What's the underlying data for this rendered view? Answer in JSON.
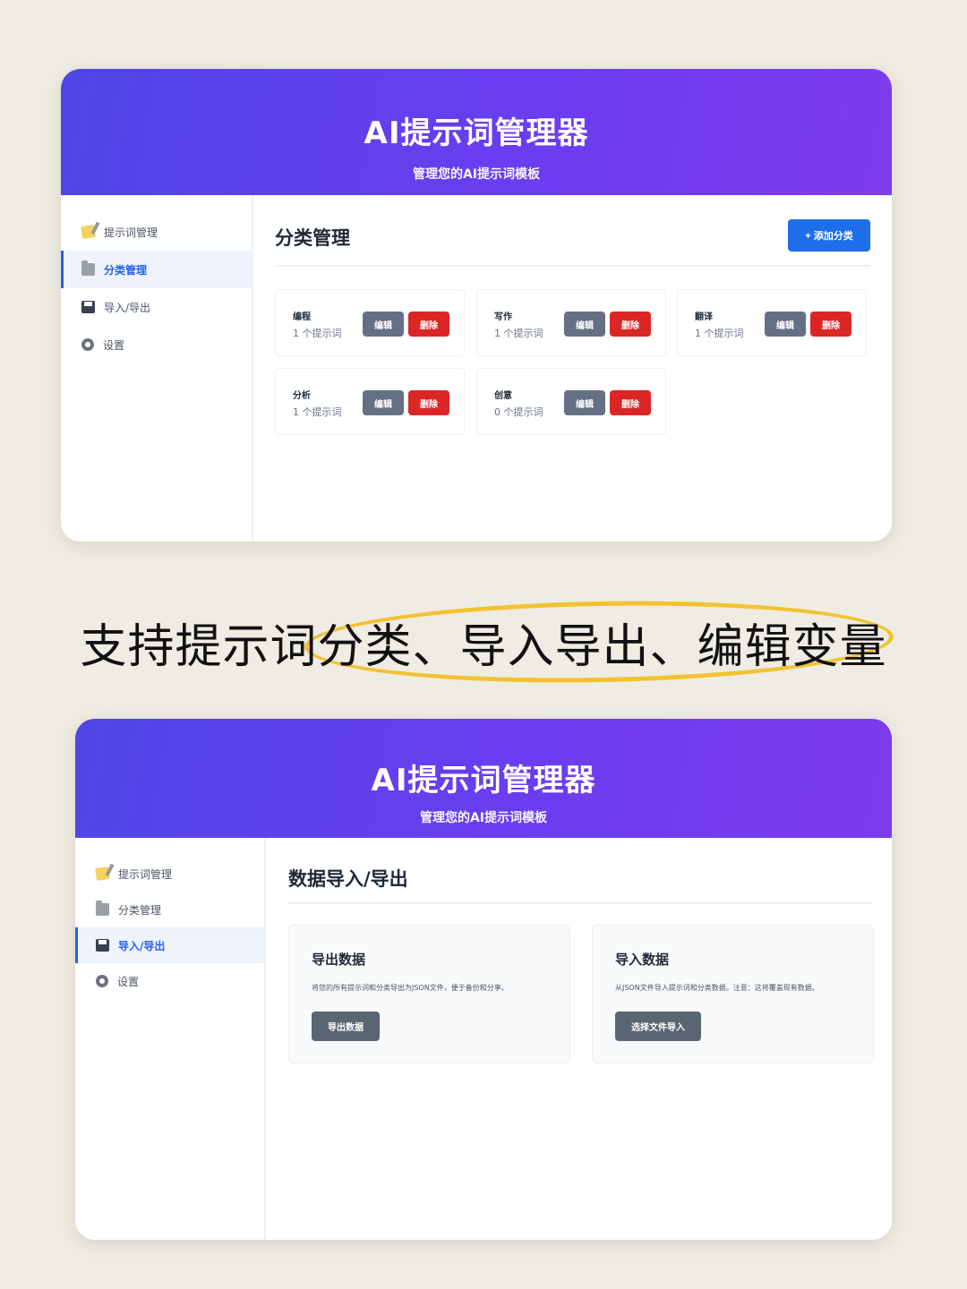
{
  "colors": {
    "header_gradient_start": "#4f46e5",
    "header_gradient_end": "#7e3bea",
    "primary_button": "#1d6ee8",
    "edit_button": "#667085",
    "delete_button": "#dc2626",
    "highlight": "#f2c230",
    "background": "#efece3"
  },
  "app": {
    "title": "AI提示词管理器",
    "subtitle": "管理您的AI提示词模板"
  },
  "nav": [
    {
      "label": "提示词管理",
      "icon": "memo-icon"
    },
    {
      "label": "分类管理",
      "icon": "folder-icon"
    },
    {
      "label": "导入/导出",
      "icon": "floppy-disk-icon"
    },
    {
      "label": "设置",
      "icon": "gear-icon"
    }
  ],
  "screen1": {
    "active_nav": "分类管理",
    "section_title": "分类管理",
    "add_button": "+ 添加分类",
    "edit_label": "编辑",
    "delete_label": "删除",
    "categories": [
      {
        "name": "编程",
        "count": "1 个提示词"
      },
      {
        "name": "写作",
        "count": "1 个提示词"
      },
      {
        "name": "翻译",
        "count": "1 个提示词"
      },
      {
        "name": "分析",
        "count": "1 个提示词"
      },
      {
        "name": "创意",
        "count": "0 个提示词"
      }
    ]
  },
  "caption": "支持提示词分类、导入导出、编辑变量",
  "screen2": {
    "active_nav": "导入/导出",
    "section_title": "数据导入/导出",
    "export": {
      "title": "导出数据",
      "description": "将您的所有提示词和分类导出为JSON文件，便于备份和分享。",
      "button": "导出数据"
    },
    "import": {
      "title": "导入数据",
      "description": "从JSON文件导入提示词和分类数据。注意：这将覆盖现有数据。",
      "button": "选择文件导入"
    }
  }
}
